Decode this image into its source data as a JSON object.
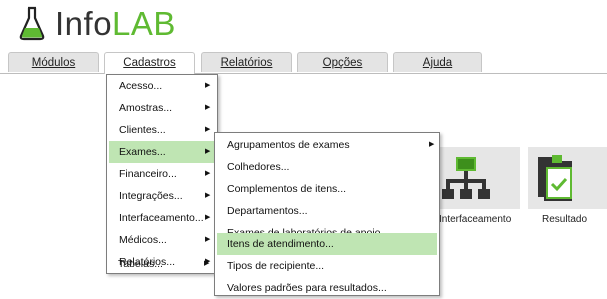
{
  "app": {
    "name_part1": "Info",
    "name_part2": "LAB",
    "colors": {
      "brand_green": "#5fba32",
      "highlight": "#bfe5b3"
    }
  },
  "menubar": {
    "tabs": [
      {
        "label": "Módulos"
      },
      {
        "label": "Cadastros"
      },
      {
        "label": "Relatórios"
      },
      {
        "label": "Opções"
      },
      {
        "label": "Ajuda"
      }
    ]
  },
  "cadastros_menu": {
    "items": [
      {
        "label": "Acesso...",
        "submenu": true
      },
      {
        "label": "Amostras...",
        "submenu": true
      },
      {
        "label": "Clientes...",
        "submenu": true
      },
      {
        "label": "Exames...",
        "submenu": true,
        "highlighted": true
      },
      {
        "label": "Financeiro...",
        "submenu": true
      },
      {
        "label": "Integrações...",
        "submenu": true
      },
      {
        "label": "Interfaceamento...",
        "submenu": true
      },
      {
        "label": "Médicos...",
        "submenu": true
      },
      {
        "label": "Relatórios...",
        "submenu": true
      },
      {
        "label": "Tabelas...",
        "submenu": true
      }
    ]
  },
  "exames_menu": {
    "items": [
      {
        "label": "Agrupamentos de exames",
        "submenu": true
      },
      {
        "label": "Colhedores..."
      },
      {
        "label": "Complementos de itens..."
      },
      {
        "label": "Departamentos..."
      },
      {
        "label": "Exames de laboratórios de apoio..."
      },
      {
        "label": "Itens de atendimento...",
        "highlighted": true
      },
      {
        "label": "Tipos de recipiente..."
      },
      {
        "label": "Valores padrões para resultados..."
      }
    ]
  },
  "shortcuts": [
    {
      "label": "Interfaceamento",
      "icon": "network-icon"
    },
    {
      "label": "Resultado",
      "icon": "clipboard-check-icon"
    }
  ]
}
